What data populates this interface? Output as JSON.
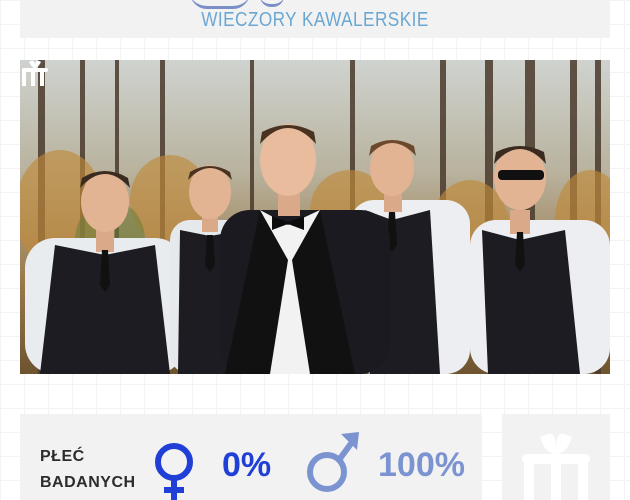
{
  "header": {
    "subtitle": "WIECZORY KAWALERSKIE"
  },
  "photo": {
    "alt_icon": "group-photo"
  },
  "stats": {
    "label": "PŁEĆ BADANYCH",
    "female": {
      "icon": "female-symbol-icon",
      "value": "0%",
      "color": "#1f3fd6"
    },
    "male": {
      "icon": "male-symbol-icon",
      "value": "100%",
      "color": "#7b93d1"
    }
  },
  "brand": {
    "icon": "brand-logo-icon",
    "accent": "#6aa7d2"
  }
}
